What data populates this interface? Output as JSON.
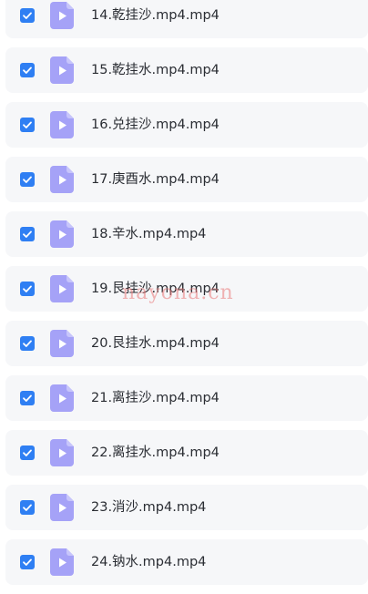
{
  "files": [
    {
      "name": "14.乾挂沙.mp4.mp4",
      "checked": true
    },
    {
      "name": "15.乾挂水.mp4.mp4",
      "checked": true
    },
    {
      "name": "16.兑挂沙.mp4.mp4",
      "checked": true
    },
    {
      "name": "17.庚酉水.mp4.mp4",
      "checked": true
    },
    {
      "name": "18.辛水.mp4.mp4",
      "checked": true
    },
    {
      "name": "19.艮挂沙.mp4.mp4",
      "checked": true
    },
    {
      "name": "20.艮挂水.mp4.mp4",
      "checked": true
    },
    {
      "name": "21.离挂沙.mp4.mp4",
      "checked": true
    },
    {
      "name": "22.离挂水.mp4.mp4",
      "checked": true
    },
    {
      "name": "23.消沙.mp4.mp4",
      "checked": true
    },
    {
      "name": "24.钠水.mp4.mp4",
      "checked": true
    }
  ],
  "watermark": "nayona.cn",
  "colors": {
    "checkbox": "#2f7ff3",
    "video_icon": "#a5a2f7",
    "row_background": "#f6f7f9",
    "watermark": "#e97878"
  },
  "icons": {
    "checkbox": "checkmark-icon",
    "file": "video-file-icon"
  }
}
